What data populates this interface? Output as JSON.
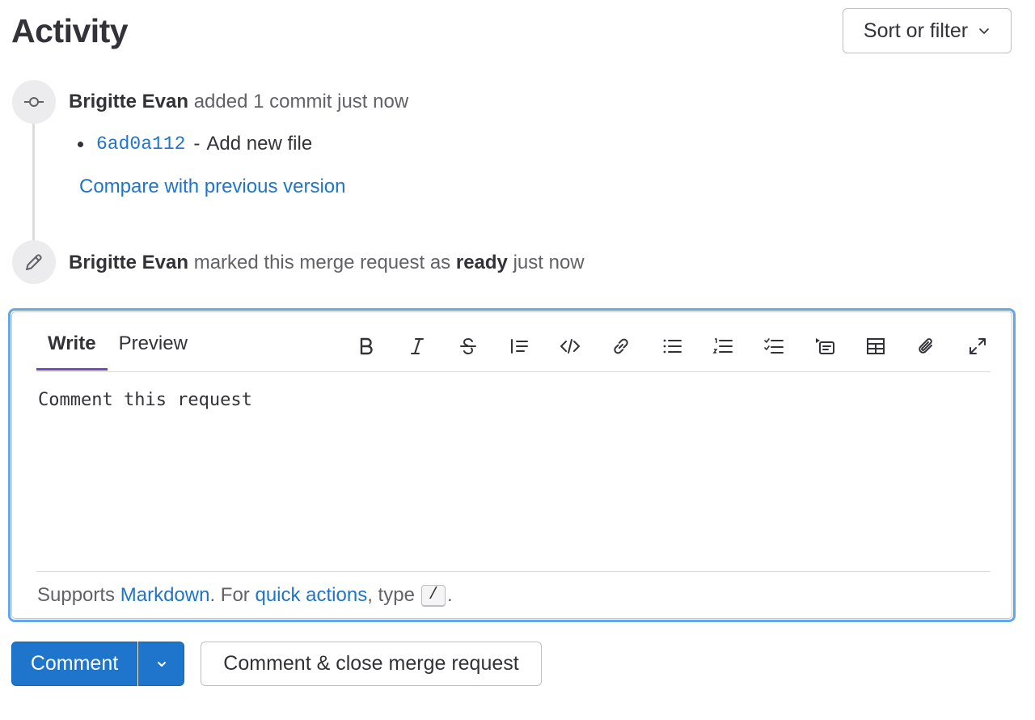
{
  "header": {
    "title": "Activity",
    "sort_label": "Sort or filter"
  },
  "events": [
    {
      "icon": "commit-icon",
      "author": "Brigitte Evan",
      "action": "added 1 commit just now",
      "commits": [
        {
          "sha": "6ad0a112",
          "separator": "-",
          "message": "Add new file"
        }
      ],
      "compare_link": "Compare with previous version"
    },
    {
      "icon": "pencil-icon",
      "author": "Brigitte Evan",
      "action_before": "marked this merge request as",
      "action_strong": "ready",
      "action_after": "just now"
    }
  ],
  "editor": {
    "tabs": [
      {
        "label": "Write",
        "active": true
      },
      {
        "label": "Preview",
        "active": false
      }
    ],
    "toolbar": [
      "bold-icon",
      "italic-icon",
      "strikethrough-icon",
      "quote-icon",
      "code-icon",
      "link-icon",
      "bulleted-list-icon",
      "numbered-list-icon",
      "task-list-icon",
      "collapsible-section-icon",
      "table-icon",
      "attach-file-icon",
      "fullscreen-icon"
    ],
    "text": "Comment this request",
    "footer": {
      "supports": "Supports",
      "markdown_link": "Markdown",
      "for_text": ". For",
      "quick_actions_link": "quick actions",
      "type_text": ", type",
      "kbd": "/",
      "end": "."
    }
  },
  "actions": {
    "comment_label": "Comment",
    "close_label": "Comment & close merge request"
  },
  "colors": {
    "link": "#1f75cb",
    "primary": "#1f75cb",
    "focus_border": "#63a6e9",
    "active_tab": "#6e49cb"
  }
}
